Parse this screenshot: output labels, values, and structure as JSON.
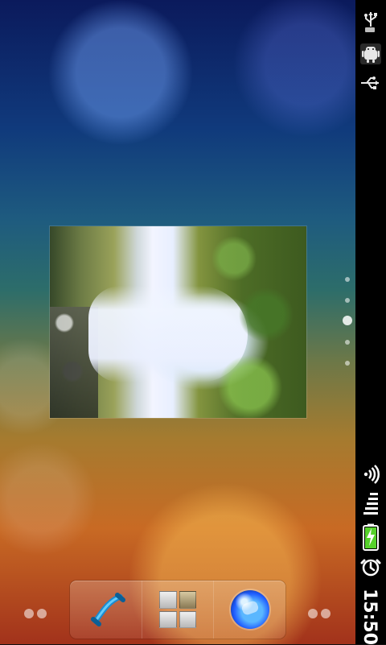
{
  "status_bar": {
    "time": "15:50",
    "icons": [
      "usb-icon",
      "android-debug-icon",
      "usb-icon",
      "wifi-icon",
      "signal-icon",
      "battery-charging-icon",
      "alarm-icon"
    ]
  },
  "home": {
    "photo_widget": {
      "subject": "waterfall"
    },
    "page_indicator": {
      "total": 5,
      "current": 3
    }
  },
  "dock": {
    "items": [
      {
        "name": "phone",
        "icon": "phone-icon"
      },
      {
        "name": "all-apps",
        "icon": "app-grid-icon"
      },
      {
        "name": "browser",
        "icon": "globe-icon"
      }
    ]
  },
  "colors": {
    "status_bar_bg": "#000000",
    "dock_highlight": "rgba(255,255,255,0.22)"
  }
}
